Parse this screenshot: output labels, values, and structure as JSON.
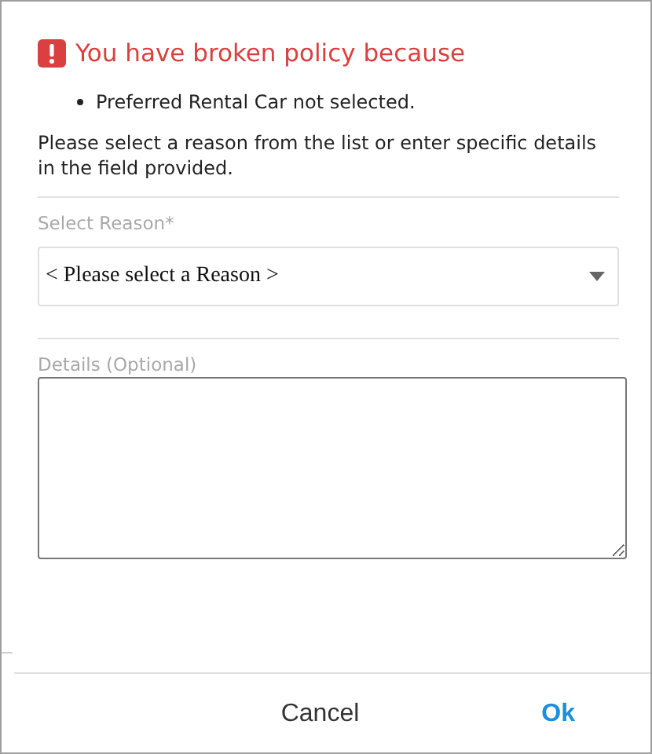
{
  "dialog": {
    "title": "You have broken policy because",
    "violations": [
      "Preferred Rental Car not selected."
    ],
    "instructions": "Please select a reason from the list or enter specific details in the field provided.",
    "reason_field": {
      "label": "Select Reason*",
      "value": "< Please select a Reason >"
    },
    "details_field": {
      "label": "Details (Optional)"
    },
    "buttons": [
      {
        "label": "Cancel",
        "kind": "secondary"
      },
      {
        "label": "Ok",
        "kind": "primary"
      }
    ]
  }
}
